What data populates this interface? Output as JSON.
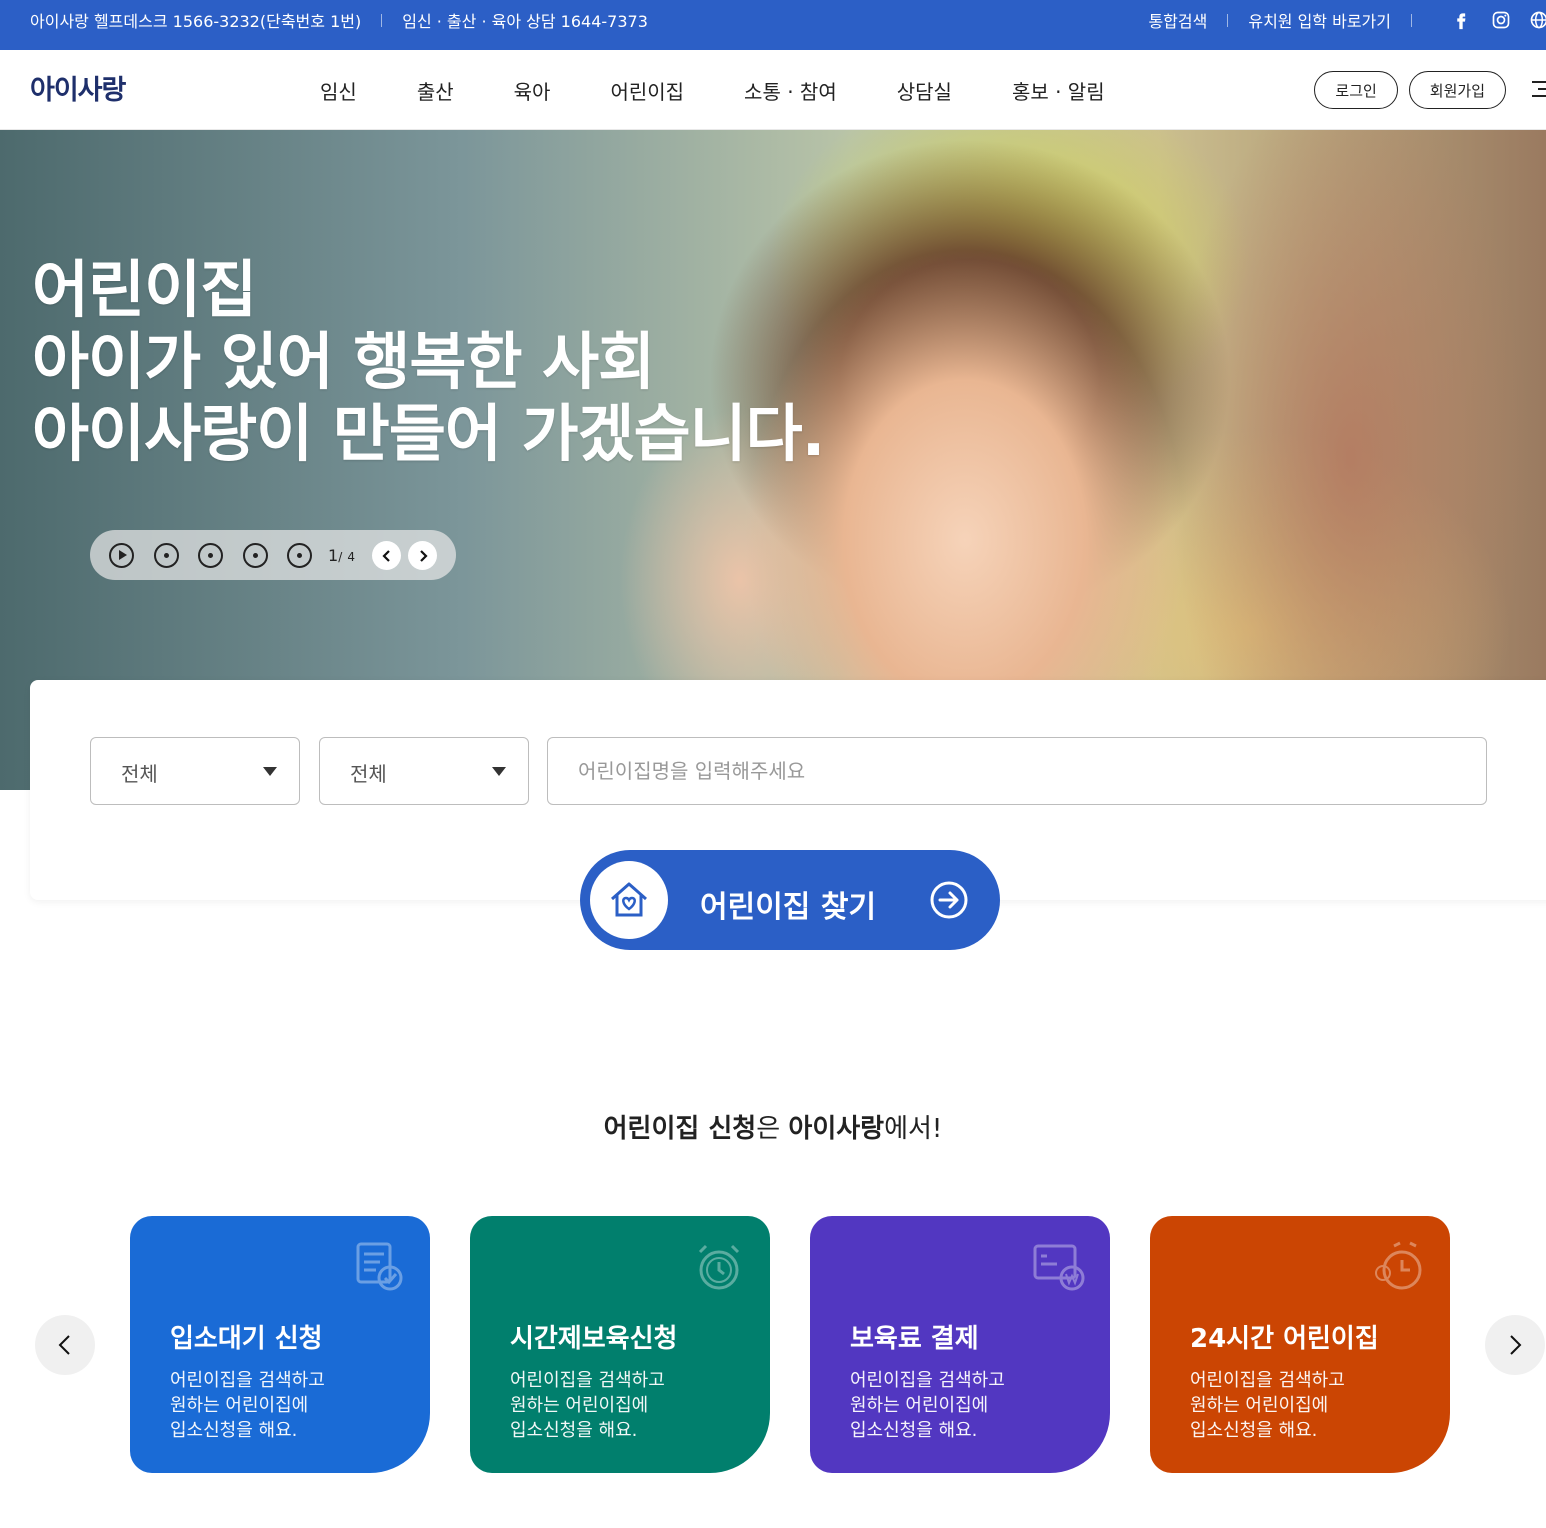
{
  "topbar": {
    "helpdesk": "아이사랑 헬프데스크 1566-3232(단축번호 1번)",
    "consult": "임신 · 출산 · 육아 상담 1644-7373",
    "search_link": "통합검색",
    "kindergarten_link": "유치원 입학 바로가기",
    "sns": [
      "facebook-icon",
      "instagram-icon",
      "globe-icon"
    ]
  },
  "header": {
    "logo": "아이사랑",
    "nav": [
      "임신",
      "출산",
      "육아",
      "어린이집",
      "소통 · 참여",
      "상담실",
      "홍보 · 알림"
    ],
    "login": "로그인",
    "signup": "회원가입"
  },
  "hero": {
    "lines": [
      "어린이집",
      "아이가 있어 행복한 사회",
      "아이사랑이 만들어 가겠습니다."
    ],
    "current": "1",
    "separator": "/",
    "total": "4"
  },
  "search": {
    "select1": "전체",
    "select2": "전체",
    "placeholder": "어린이집명을 입력해주세요",
    "button": "어린이집 찾기"
  },
  "section": {
    "title_b1": "어린이집 신청",
    "title_t1": "은 ",
    "title_b2": "아이사랑",
    "title_t2": "에서!"
  },
  "cards": [
    {
      "title": "입소대기 신청",
      "desc1": "어린이집을 검색하고",
      "desc2": "원하는 어린이집에",
      "desc3": "입소신청을 해요.",
      "color": "#1a6bd6",
      "icon": "application-check-icon"
    },
    {
      "title": "시간제보육신청",
      "desc1": "어린이집을 검색하고",
      "desc2": "원하는 어린이집에",
      "desc3": "입소신청을 해요.",
      "color": "#017f6d",
      "icon": "alarm-clock-icon"
    },
    {
      "title": "보육료 결제",
      "desc1": "어린이집을 검색하고",
      "desc2": "원하는 어린이집에",
      "desc3": "입소신청을 해요.",
      "color": "#5237c1",
      "icon": "payment-card-icon"
    },
    {
      "title": "24시간 어린이집",
      "desc1": "어린이집을 검색하고",
      "desc2": "원하는 어린이집에",
      "desc3": "입소신청을 해요.",
      "color": "#cb4503",
      "icon": "24-hour-clock-icon"
    }
  ],
  "colors": {
    "brand_blue": "#2c5fc6",
    "logo_navy": "#1e2f6b"
  }
}
